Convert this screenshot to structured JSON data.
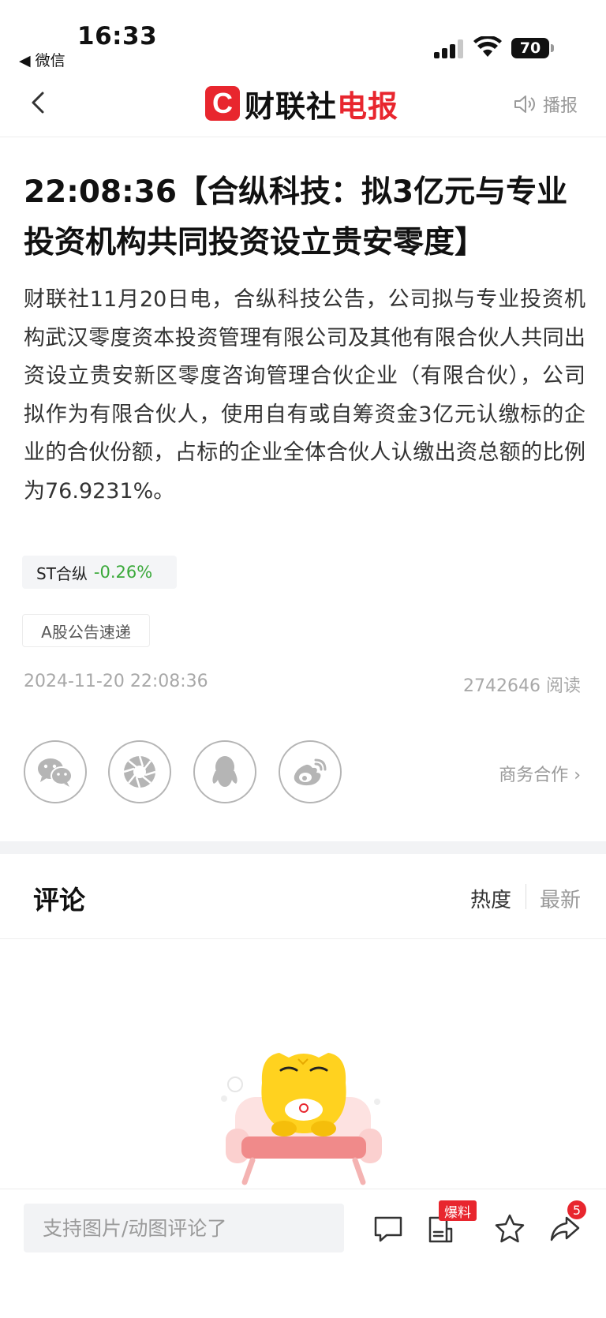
{
  "status_bar": {
    "time": "16:33",
    "back_app": "◀ 微信",
    "battery": "70"
  },
  "nav": {
    "logo_letter": "C",
    "brand_name": "财联社",
    "brand_suffix": "电报",
    "broadcast_label": "播报"
  },
  "article": {
    "headline": "22:08:36【合纵科技：拟3亿元与专业投资机构共同投资设立贵安零度】",
    "body": "财联社11月20日电，合纵科技公告，公司拟与专业投资机构武汉零度资本投资管理有限公司及其他有限合伙人共同出资设立贵安新区零度咨询管理合伙企业（有限合伙），公司拟作为有限合伙人，使用自有或自筹资金3亿元认缴标的企业的合伙份额，占标的企业全体合伙人认缴出资总额的比例为76.9231%。",
    "stock_name": "ST合纵",
    "stock_change": "-0.26%",
    "stock_change_color": "#3aa93a",
    "tag": "A股公告速递",
    "date": "2024-11-20 22:08:36",
    "reads": "2742646 阅读",
    "business_link": "商务合作 ›"
  },
  "share": {
    "icons": [
      "wechat-icon",
      "moments-icon",
      "qq-icon",
      "weibo-icon"
    ]
  },
  "comments": {
    "title": "评论",
    "sort_hot": "热度",
    "sort_new": "最新"
  },
  "bottom_bar": {
    "input_placeholder": "支持图片/动图评论了",
    "baoliao_label": "爆料",
    "share_count": "5"
  },
  "colors": {
    "brand_red": "#e8262e"
  }
}
